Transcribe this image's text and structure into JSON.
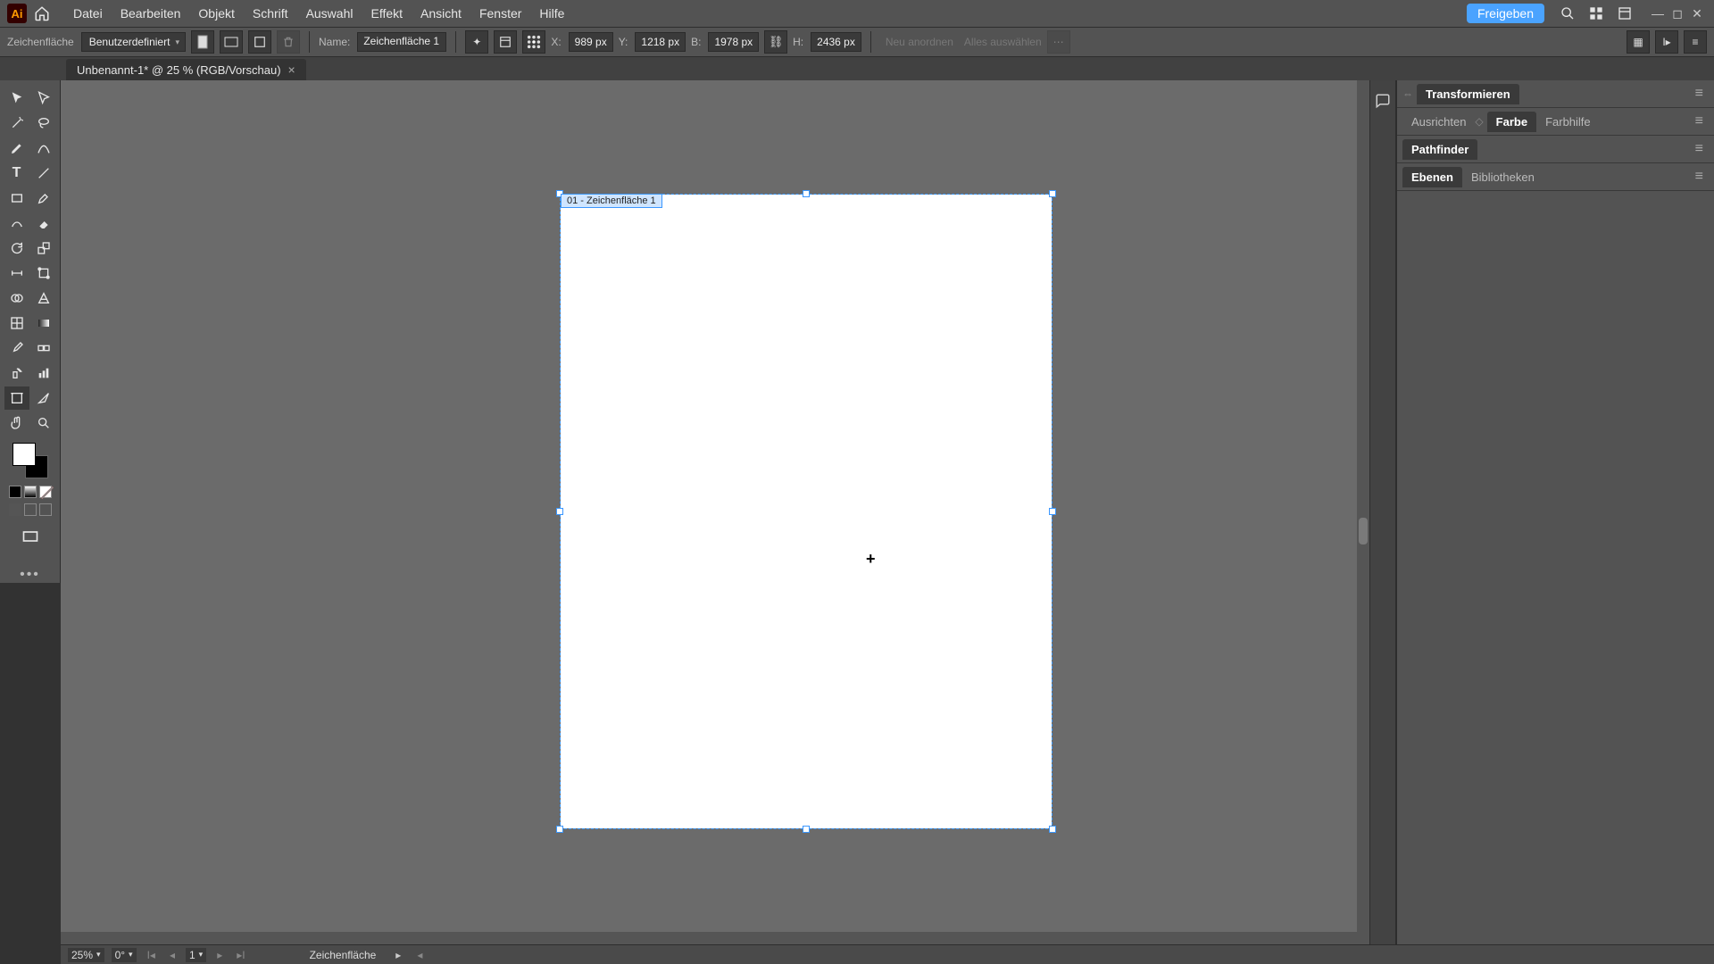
{
  "menu": {
    "items": [
      "Datei",
      "Bearbeiten",
      "Objekt",
      "Schrift",
      "Auswahl",
      "Effekt",
      "Ansicht",
      "Fenster",
      "Hilfe"
    ],
    "share": "Freigeben"
  },
  "control": {
    "mode_label": "Zeichenfläche",
    "preset": "Benutzerdefiniert",
    "name_label": "Name:",
    "name_value": "Zeichenfläche 1",
    "x_label": "X:",
    "x_value": "989 px",
    "y_label": "Y:",
    "y_value": "1218 px",
    "w_label": "B:",
    "w_value": "1978 px",
    "h_label": "H:",
    "h_value": "2436 px",
    "ghost1": "Neu anordnen",
    "ghost2": "Alles auswählen"
  },
  "doc": {
    "tab_title": "Unbenannt-1* @ 25 % (RGB/Vorschau)",
    "artboard_label": "01 - Zeichenfläche 1"
  },
  "panels": {
    "g1": [
      "Transformieren"
    ],
    "g1_active": 0,
    "g2": [
      "Ausrichten",
      "Farbe",
      "Farbhilfe"
    ],
    "g2_active": 1,
    "g3": [
      "Pathfinder"
    ],
    "g3_active": 0,
    "g4": [
      "Ebenen",
      "Bibliotheken"
    ],
    "g4_active": 0
  },
  "status": {
    "zoom": "25%",
    "rotate": "0°",
    "artboard_num": "1",
    "label": "Zeichenfläche"
  }
}
